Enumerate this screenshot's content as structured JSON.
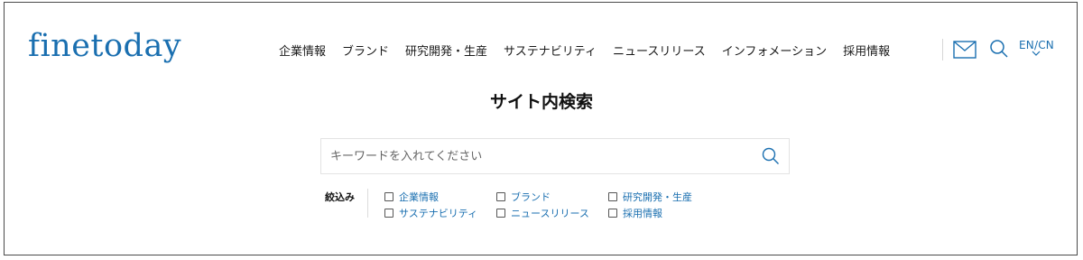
{
  "header": {
    "logo": "finetoday",
    "nav": [
      "企業情報",
      "ブランド",
      "研究開発・生産",
      "サステナビリティ",
      "ニュースリリース",
      "インフォメーション",
      "採用情報"
    ],
    "icons": [
      "mail-icon",
      "search-icon"
    ],
    "lang": "EN/CN",
    "lang_icon": "chevron-down-icon"
  },
  "main": {
    "title": "サイト内検索",
    "search": {
      "placeholder": "キーワードを入れてください",
      "value": "",
      "icon": "search-icon"
    },
    "filter": {
      "label": "絞込み",
      "options": [
        {
          "label": "企業情報",
          "checked": false
        },
        {
          "label": "ブランド",
          "checked": false
        },
        {
          "label": "研究開発・生産",
          "checked": false
        },
        {
          "label": "サステナビリティ",
          "checked": false
        },
        {
          "label": "ニュースリリース",
          "checked": false
        },
        {
          "label": "採用情報",
          "checked": false
        }
      ]
    }
  },
  "colors": {
    "brand": "#1a6fb0",
    "text": "#1a1a1a",
    "border": "#4a4a4a",
    "input_border": "#e3e3e3"
  }
}
